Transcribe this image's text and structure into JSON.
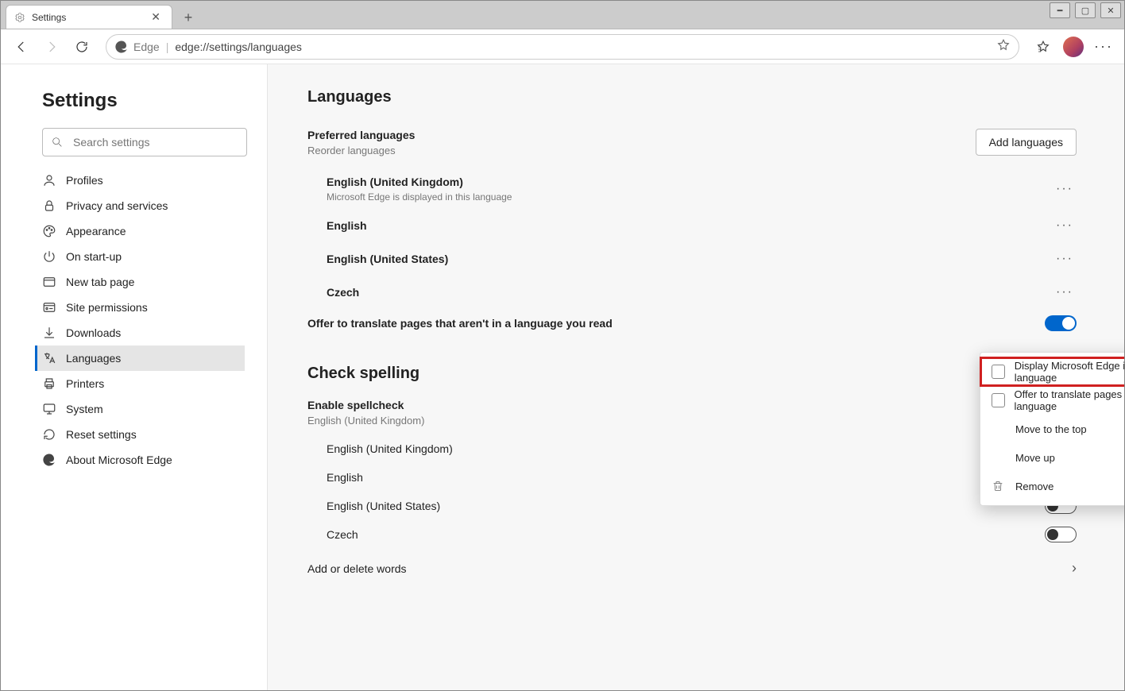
{
  "window": {
    "tab_title": "Settings",
    "app_name": "Edge",
    "url": "edge://settings/languages"
  },
  "sidebar": {
    "title": "Settings",
    "search_placeholder": "Search settings",
    "items": [
      {
        "label": "Profiles"
      },
      {
        "label": "Privacy and services"
      },
      {
        "label": "Appearance"
      },
      {
        "label": "On start-up"
      },
      {
        "label": "New tab page"
      },
      {
        "label": "Site permissions"
      },
      {
        "label": "Downloads"
      },
      {
        "label": "Languages"
      },
      {
        "label": "Printers"
      },
      {
        "label": "System"
      },
      {
        "label": "Reset settings"
      },
      {
        "label": "About Microsoft Edge"
      }
    ]
  },
  "main": {
    "heading": "Languages",
    "preferred": {
      "title": "Preferred languages",
      "subtitle": "Reorder languages",
      "add_button": "Add languages",
      "items": [
        {
          "name": "English (United Kingdom)",
          "desc": "Microsoft Edge is displayed in this language"
        },
        {
          "name": "English",
          "desc": ""
        },
        {
          "name": "English (United States)",
          "desc": ""
        },
        {
          "name": "Czech",
          "desc": ""
        }
      ],
      "translate_label": "Offer to translate pages that aren't in a language you read"
    },
    "spelling": {
      "heading": "Check spelling",
      "enable_label": "Enable spellcheck",
      "enable_desc": "English (United Kingdom)",
      "items": [
        {
          "name": "English (United Kingdom)",
          "state": "on"
        },
        {
          "name": "English",
          "state": "disabled"
        },
        {
          "name": "English (United States)",
          "state": "off"
        },
        {
          "name": "Czech",
          "state": "off"
        }
      ],
      "add_words": "Add or delete words"
    },
    "context_menu": {
      "display": "Display Microsoft Edge in this language",
      "offer": "Offer to translate pages in this language",
      "top": "Move to the top",
      "up": "Move up",
      "remove": "Remove"
    }
  }
}
